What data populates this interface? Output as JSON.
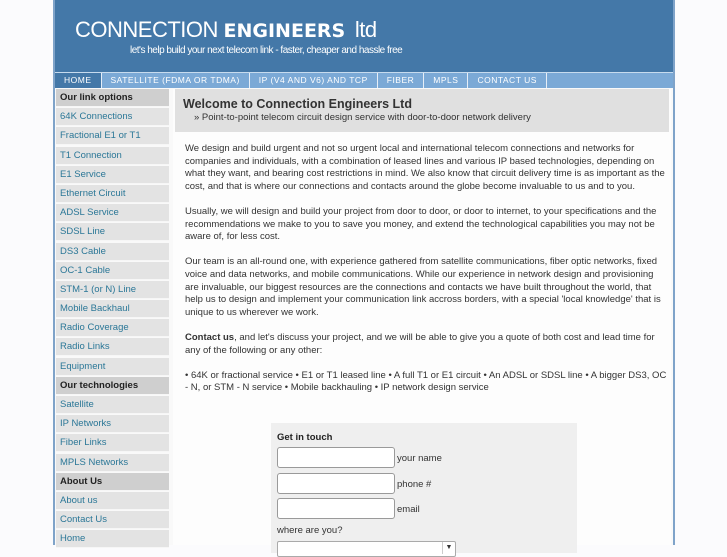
{
  "header": {
    "logo_light": "CONNECTION",
    "logo_bold": "ENGINEERS",
    "logo_ltd": "ltd",
    "tagline": "let's help build your next telecom link - faster, cheaper and hassle free"
  },
  "nav": {
    "items": [
      {
        "label": "HOME"
      },
      {
        "label": "SATELLITE (FDMA OR TDMA)"
      },
      {
        "label": "IP (V4 AND V6) AND TCP"
      },
      {
        "label": "FIBER"
      },
      {
        "label": "MPLS"
      },
      {
        "label": "CONTACT US"
      }
    ]
  },
  "sidebar": {
    "link_options_heading": "Our link options",
    "link_options": [
      "64K Connections",
      "Fractional E1 or T1",
      "T1 Connection",
      "E1 Service",
      "Ethernet Circuit",
      "ADSL Service",
      "SDSL Line",
      "DS3 Cable",
      "OC-1 Cable",
      "STM-1 (or N) Line",
      "Mobile Backhaul",
      "Radio Coverage",
      "Radio Links",
      "Equipment"
    ],
    "technologies_heading": "Our technologies",
    "technologies": [
      "Satellite",
      "IP Networks",
      "Fiber Links",
      "MPLS Networks"
    ],
    "about_heading": "About Us",
    "about": [
      "About us",
      "Contact Us",
      "Home"
    ]
  },
  "main": {
    "title": "Welcome to Connection Engineers Ltd",
    "subtitle": "» Point-to-point telecom circuit design service with door-to-door network delivery",
    "paragraphs": [
      "We design and build urgent and not so urgent local and international telecom connections and networks for companies and individuals, with a combination of leased lines and various IP based technologies, depending on what they want, and bearing cost restrictions in mind. We also know that circuit delivery time is as important as the cost, and that is where our connections and contacts around the globe become invaluable to us and to you.",
      "Usually, we will design and build your project from door to door, or door to internet, to your specifications and the recommendations we make to you to save you money, and extend the technological capabilities you may not be aware of, for less cost.",
      "Our team is an all-round one, with experience gathered from satellite communications, fiber optic networks, fixed voice and data networks, and mobile communications. While our experience in network design and provisioning are invaluable, our biggest resources are the connections and contacts we have built throughout the world, that help us to design and implement your communication link accross borders, with a special 'local knowledge' that is unique to us wherever we work."
    ],
    "contact_bold": "Contact us",
    "contact_rest": ", and let's discuss your project, and we will be able to give you a quote of both cost and lead time for any of the following or any other:",
    "services": "• 64K or fractional service  • E1 or T1 leased line  • A full T1 or E1 circuit  • An ADSL or SDSL line  • A bigger DS3, OC - N, or STM - N service  • Mobile backhauling  • IP network design service"
  },
  "form": {
    "title": "Get in touch",
    "name_label": "your name",
    "phone_label": "phone #",
    "email_label": "email",
    "name_value": "",
    "phone_value": "",
    "email_value": "",
    "where_label": "where are you?",
    "location_selected": ""
  }
}
